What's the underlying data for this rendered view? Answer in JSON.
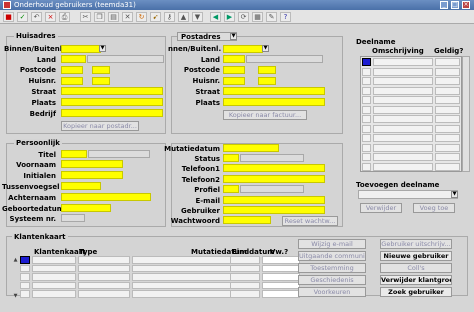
{
  "window": {
    "title": "Onderhoud gebruikers (teemda31)",
    "minimize": "_",
    "maximize": "□",
    "close": "×"
  },
  "toolbar": {
    "icons": [
      "save-icon",
      "check-icon",
      "undo-icon",
      "delete-icon",
      "print-icon",
      "cut-icon",
      "copy-icon",
      "paste-icon",
      "clear-icon",
      "rotate-icon",
      "run-icon",
      "key-icon",
      "up-icon",
      "down-icon",
      "prev-icon",
      "next-icon",
      "refresh-icon",
      "export-icon",
      "attach-icon",
      "help-icon"
    ]
  },
  "huisadres": {
    "title": "Huisadres",
    "labels": [
      "Binnen/Buitenl.",
      "Land",
      "Postcode",
      "Huisnr.",
      "Straat",
      "Plaats",
      "Bedrijf"
    ],
    "copy_button": "Kopieer naar postadr..."
  },
  "postadres": {
    "select": "Postadres",
    "labels": [
      "nnen/Buitenl.",
      "Land",
      "Postcode",
      "Huisnr.",
      "Straat",
      "Plaats"
    ],
    "copy_button": "Kopieer naar factuur..."
  },
  "deelname": {
    "title": "Deelname",
    "col_desc": "Omschrijving",
    "col_valid": "Geldig?",
    "rows": 12
  },
  "persoonlijk": {
    "title": "Persoonlijk",
    "labels": [
      "Titel",
      "Voornaam",
      "Initialen",
      "Tussenvoegsel",
      "Achternaam",
      "Geboortedatum",
      "Systeem nr."
    ]
  },
  "account": {
    "labels": [
      "Mutatiedatum",
      "Status",
      "Telefoon1",
      "Telefoon2",
      "Profiel",
      "E-mail",
      "Gebruiker",
      "Wachtwoord"
    ],
    "reset_button": "Reset wachtw..."
  },
  "toevoegen": {
    "title": "Toevoegen deelname",
    "remove_button": "Verwijder",
    "add_button": "Voeg toe"
  },
  "klantenkaart": {
    "title": "Klantenkaart",
    "columns": [
      "Klantenkaart",
      "Type",
      "Mutatiedatum",
      "Einddatum",
      "Vw.?"
    ],
    "rows": 5
  },
  "actions": {
    "left": [
      "Wijzig e-mail",
      "Uitgaande communi...",
      "Toestemming",
      "Geschiedenis",
      "Voorkeuren"
    ],
    "right": [
      "Gebruiker uitschrijv...",
      "Nieuwe gebruiker",
      "Coll's",
      "Verwijder klantgroep",
      "Zoek gebruiker"
    ]
  }
}
